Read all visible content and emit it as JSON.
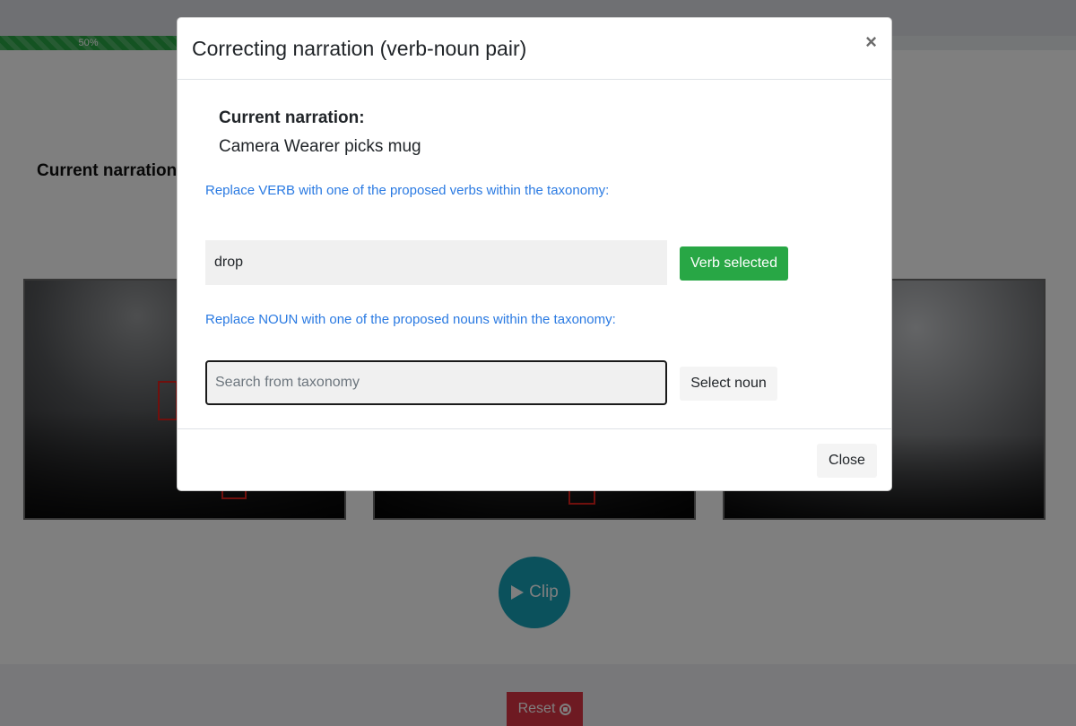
{
  "background": {
    "progress": {
      "value": 0.5,
      "label": "50%"
    },
    "heading": "Current narration",
    "frames": [
      {
        "name": "frame-1"
      },
      {
        "name": "frame-2"
      },
      {
        "name": "frame-3"
      }
    ],
    "clip_button": {
      "icon": "play-icon",
      "label": "Clip"
    },
    "reset_button": {
      "label": "Reset",
      "icon": "stop-circle-icon"
    }
  },
  "modal": {
    "title": "Correcting narration (verb-noun pair)",
    "close_x": "×",
    "current_label": "Current narration:",
    "current_text": "Camera Wearer picks mug",
    "verb_hint": "Replace VERB with one of the proposed verbs within the taxonomy:",
    "verb_value": "drop",
    "verb_button": "Verb selected",
    "noun_hint": "Replace NOUN with one of the proposed nouns within the taxonomy:",
    "noun_placeholder": "Search from taxonomy",
    "noun_button": "Select noun",
    "close_button": "Close"
  },
  "colors": {
    "success": "#28a745",
    "info": "#17a2b8",
    "danger": "#dc3545",
    "link": "#2a7ae2"
  }
}
